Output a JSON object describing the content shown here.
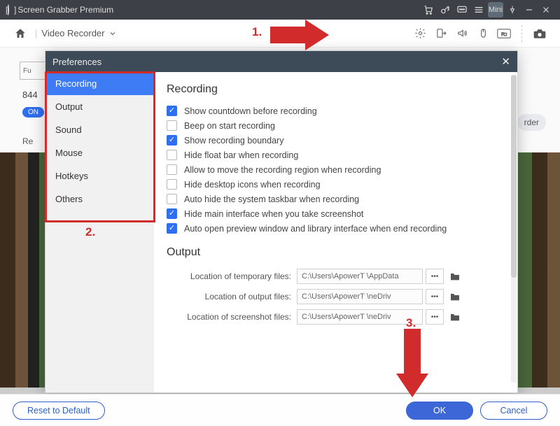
{
  "titlebar": {
    "app_name": "Screen Grabber Premium",
    "mini_label": "Mini"
  },
  "toolbar": {
    "mode_label": "Video Recorder"
  },
  "subbar": {
    "box_text": "Fu",
    "number": "844",
    "pill": "ON",
    "rec_text": "Re",
    "rder_text": "rder"
  },
  "annotations": {
    "step1": "1.",
    "step2": "2.",
    "step3": "3."
  },
  "dialog": {
    "title": "Preferences",
    "sidebar": [
      {
        "label": "Recording",
        "active": true
      },
      {
        "label": "Output"
      },
      {
        "label": "Sound"
      },
      {
        "label": "Mouse"
      },
      {
        "label": "Hotkeys"
      },
      {
        "label": "Others"
      }
    ],
    "sections": {
      "recording": {
        "heading": "Recording",
        "items": [
          {
            "label": "Show countdown before recording",
            "checked": true
          },
          {
            "label": "Beep on start recording",
            "checked": false
          },
          {
            "label": "Show recording boundary",
            "checked": true
          },
          {
            "label": "Hide float bar when recording",
            "checked": false
          },
          {
            "label": "Allow to move the recording region when recording",
            "checked": false
          },
          {
            "label": "Hide desktop icons when recording",
            "checked": false
          },
          {
            "label": "Auto hide the system taskbar when recording",
            "checked": false
          },
          {
            "label": "Hide main interface when you take screenshot",
            "checked": true
          },
          {
            "label": "Auto open preview window and library interface when end recording",
            "checked": true
          }
        ]
      },
      "output": {
        "heading": "Output",
        "rows": [
          {
            "label": "Location of temporary files:",
            "path": "C:\\Users\\ApowerT       \\AppData"
          },
          {
            "label": "Location of output files:",
            "path": "C:\\Users\\ApowerT       \\neDriv"
          },
          {
            "label": "Location of screenshot files:",
            "path": "C:\\Users\\ApowerT       \\neDriv"
          }
        ]
      }
    }
  },
  "footer": {
    "reset": "Reset to Default",
    "ok": "OK",
    "cancel": "Cancel"
  }
}
